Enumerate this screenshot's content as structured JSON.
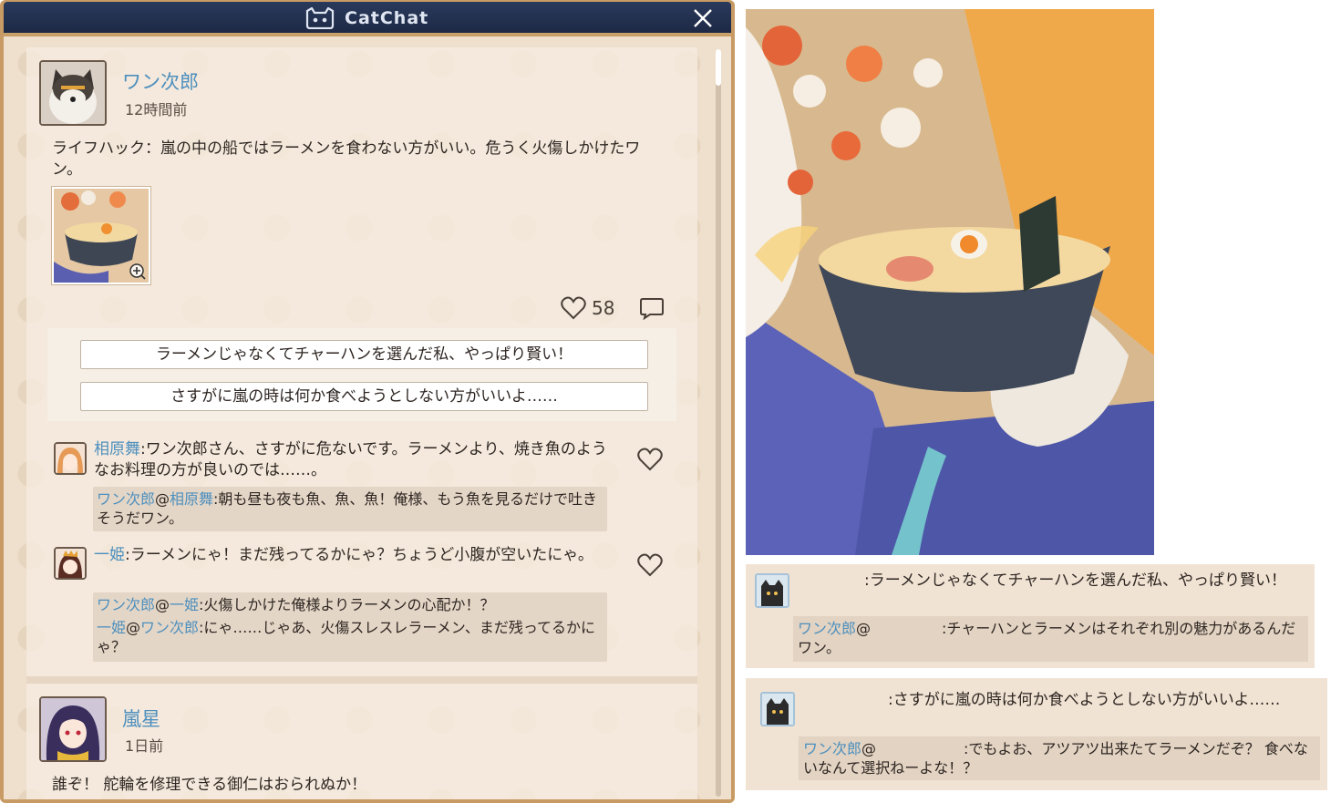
{
  "app": {
    "title": "CatChat"
  },
  "post1": {
    "author": "ワン次郎",
    "time": "12時間前",
    "text": "ライフハック：嵐の中の船ではラーメンを食わない方がいい。危うく火傷しかけたワン。",
    "likes": "58"
  },
  "reply_options": [
    "ラーメンじゃなくてチャーハンを選んだ私、やっぱり賢い！",
    "さすがに嵐の時は何か食べようとしない方がいいよ……"
  ],
  "comments": [
    {
      "author": "相原舞",
      "text": ":ワン次郎さん、さすがに危ないです。ラーメンより、焼き魚のようなお料理の方が良いのでは……。",
      "replies": [
        {
          "from": "ワン次郎",
          "to": "相原舞",
          "text": ":朝も昼も夜も魚、魚、魚！俺様、もう魚を見るだけで吐きそうだワン。"
        }
      ]
    },
    {
      "author": "一姫",
      "text": ":ラーメンにゃ！まだ残ってるかにゃ？ちょうど小腹が空いたにゃ。",
      "replies": [
        {
          "from": "ワン次郎",
          "to": "一姫",
          "text": ":火傷しかけた俺様よりラーメンの心配か！？"
        },
        {
          "from": "一姫",
          "to": "ワン次郎",
          "text": ":にゃ……じゃあ、火傷スレスレラーメン、まだ残ってるかにゃ？"
        }
      ]
    }
  ],
  "post2": {
    "author": "嵐星",
    "time": "1日前",
    "text": "誰ぞ！ 舵輪を修理できる御仁はおられぬか！"
  },
  "chat1": {
    "text": ":ラーメンじゃなくてチャーハンを選んだ私、やっぱり賢い！",
    "reply_from": "ワン次郎",
    "reply_at": "@",
    "reply_text": ":チャーハンとラーメンはそれぞれ別の魅力があるんだワン。"
  },
  "chat2": {
    "text": ":さすがに嵐の時は何か食べようとしない方がいいよ……",
    "reply_from": "ワン次郎",
    "reply_at": "@",
    "reply_text": ":でもよお、アツアツ出来たてラーメンだぞ？ 食べないなんて選択ねーよな！？"
  },
  "colors": {
    "name_blue": "#4d8fbe",
    "titlebar": "#1d2945",
    "frame": "#c89a64",
    "panel": "#efe0cd"
  }
}
